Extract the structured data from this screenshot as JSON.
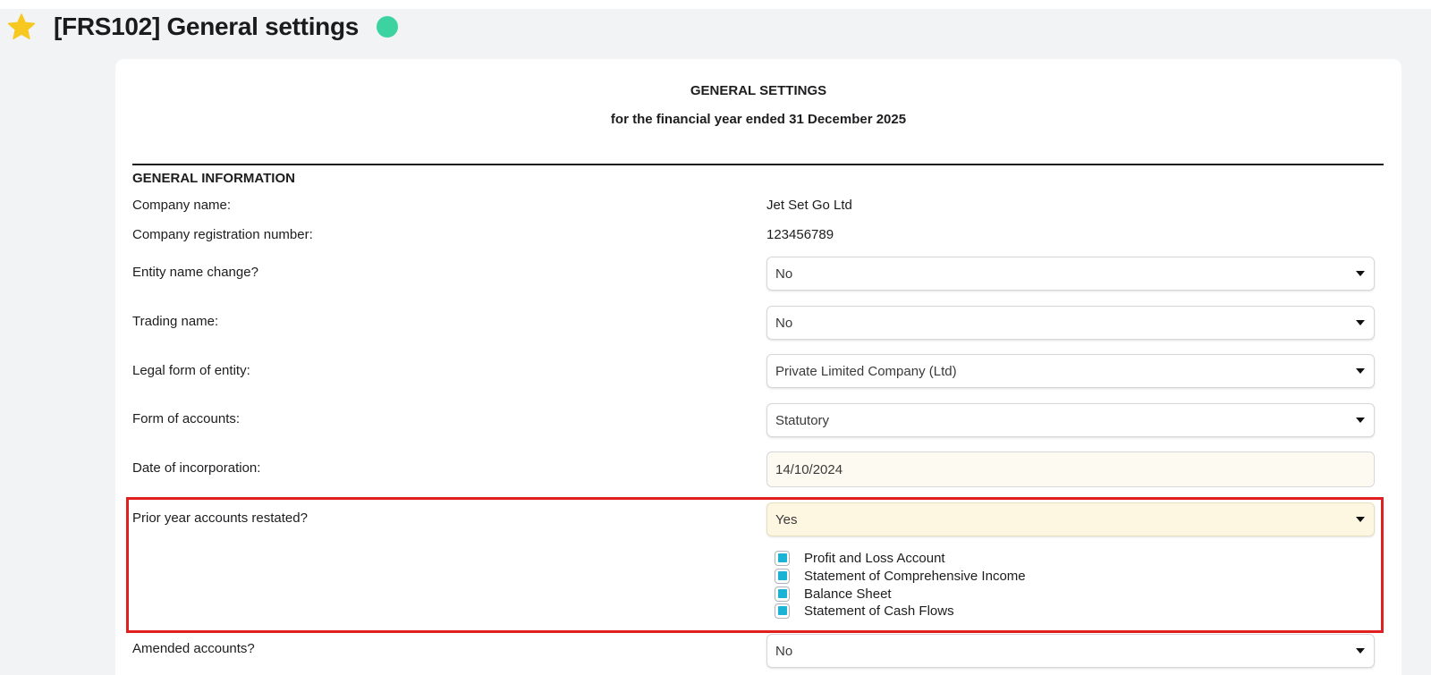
{
  "header": {
    "title": "[FRS102] General settings",
    "status_color": "#3dd3a0",
    "favorite_icon": "star-icon"
  },
  "card": {
    "title": "GENERAL SETTINGS",
    "subtitle": "for the financial year ended 31 December 2025"
  },
  "general_information": {
    "heading": "GENERAL INFORMATION",
    "company_name_label": "Company name:",
    "company_name_value": "Jet Set Go Ltd",
    "reg_number_label": "Company registration number:",
    "reg_number_value": "123456789",
    "entity_name_change_label": "Entity name change?",
    "entity_name_change_value": "No",
    "trading_name_label": "Trading name:",
    "trading_name_value": "No",
    "legal_form_label": "Legal form of entity:",
    "legal_form_value": "Private Limited Company (Ltd)",
    "form_of_accounts_label": "Form of accounts:",
    "form_of_accounts_value": "Statutory",
    "date_incorporation_label": "Date of incorporation:",
    "date_incorporation_value": "14/10/2024",
    "prior_year_restated_label": "Prior year accounts restated?",
    "prior_year_restated_value": "Yes",
    "restated_statements": [
      {
        "label": "Profit and Loss Account",
        "checked": true
      },
      {
        "label": "Statement of Comprehensive Income",
        "checked": true
      },
      {
        "label": "Balance Sheet",
        "checked": true
      },
      {
        "label": "Statement of Cash Flows",
        "checked": true
      }
    ],
    "amended_accounts_label": "Amended accounts?",
    "amended_accounts_value": "No"
  },
  "colors": {
    "highlight_border": "#e0201f",
    "checkbox_fill": "#1ab3d6",
    "highlight_field": "#fdf6e1"
  }
}
